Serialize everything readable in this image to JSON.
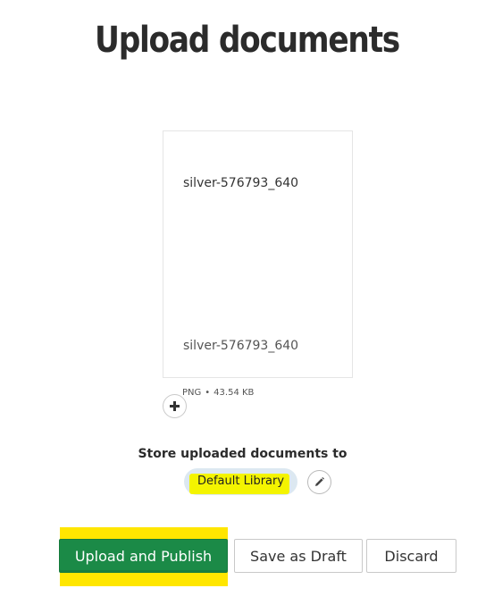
{
  "page": {
    "title": "Upload documents"
  },
  "document": {
    "name_top": "silver-576793_640",
    "name_bottom": "silver-576793_640",
    "file_type": "PNG",
    "separator": "•",
    "file_size": "43.54 KB",
    "add_icon": "plus-icon"
  },
  "storage": {
    "label": "Store uploaded documents to",
    "library": "Default Library",
    "edit_icon": "pencil-icon"
  },
  "actions": {
    "publish_label": "Upload and Publish",
    "draft_label": "Save as Draft",
    "discard_label": "Discard"
  },
  "colors": {
    "primary_green": "#1b8a47",
    "highlight_yellow": "#ffe600",
    "pill_blue": "#dce8f1"
  }
}
